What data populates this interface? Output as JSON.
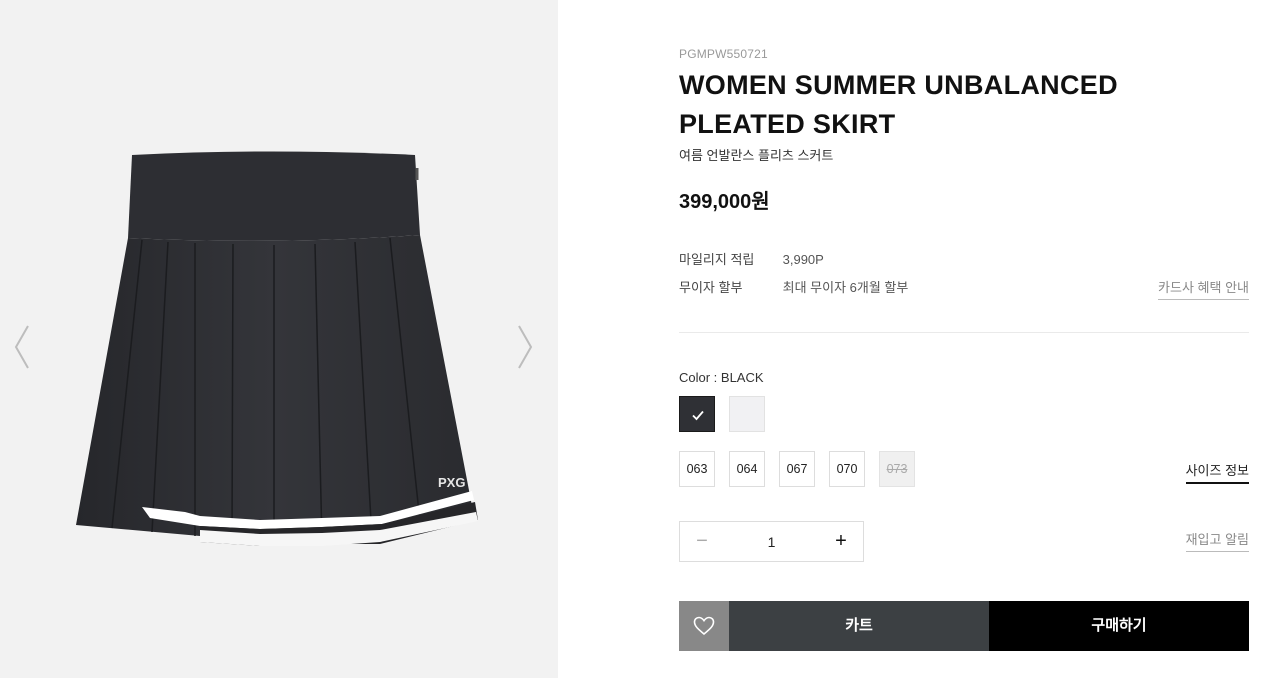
{
  "gallery": {
    "prev_icon": "chevron-left-icon",
    "next_icon": "chevron-right-icon",
    "logo_text": "PXG"
  },
  "product": {
    "sku": "PGMPW550721",
    "title_line1": "WOMEN SUMMER UNBALANCED",
    "title_line2": "PLEATED SKIRT",
    "subtitle": "여름 언발란스 플리츠 스커트",
    "price": "399,000원"
  },
  "benefits": {
    "mileage_label": "마일리지 적립",
    "mileage_value": "3,990P",
    "installment_label": "무이자 할부",
    "installment_value": "최대 무이자 6개월 할부",
    "card_link": "카드사 혜택 안내"
  },
  "options": {
    "color_label": "Color : BLACK",
    "colors": [
      {
        "name": "BLACK",
        "hex": "#2f3035",
        "selected": true
      },
      {
        "name": "WHITE",
        "hex": "#f1f1f3",
        "selected": false
      }
    ],
    "sizes": [
      {
        "label": "063",
        "available": true
      },
      {
        "label": "064",
        "available": true
      },
      {
        "label": "067",
        "available": true
      },
      {
        "label": "070",
        "available": true
      },
      {
        "label": "073",
        "available": false
      }
    ],
    "size_info_link": "사이즈 정보"
  },
  "quantity": {
    "value": "1",
    "minus": "−",
    "plus": "+",
    "restock_link": "재입고 알림"
  },
  "actions": {
    "wishlist_icon": "heart-icon",
    "cart_label": "카트",
    "buy_label": "구매하기"
  },
  "colors": {
    "cart_bg": "#3c4043",
    "buy_bg": "#000000",
    "wish_bg": "#888888",
    "gallery_bg": "#f2f2f2"
  }
}
